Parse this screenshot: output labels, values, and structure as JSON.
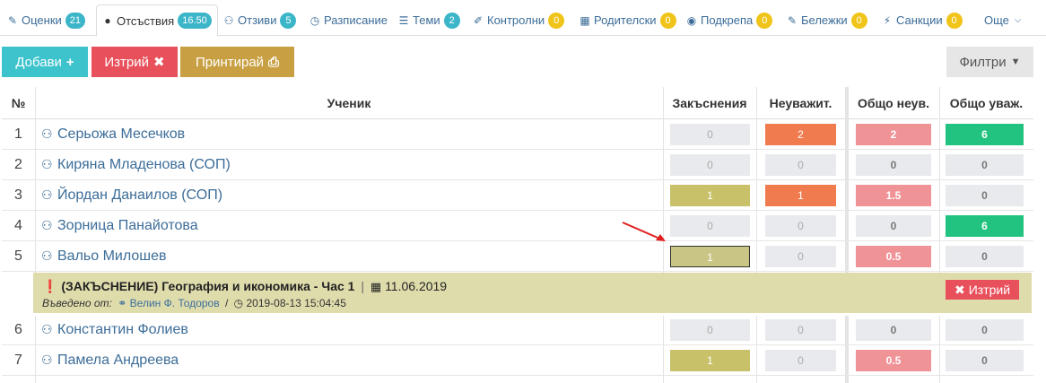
{
  "tabs": [
    {
      "label": "Оценки",
      "badge": "21",
      "badge_color": "teal",
      "icon": "pencil-icon",
      "glyph": "✎"
    },
    {
      "label": "Отсъствия",
      "badge": "16.50",
      "badge_color": "teal",
      "icon": "exclamation-circle-icon",
      "glyph": "❗",
      "active": true
    },
    {
      "label": "Отзиви",
      "badge": "5",
      "badge_color": "teal",
      "icon": "users-icon",
      "glyph": "⚇"
    },
    {
      "label": "Разписание",
      "icon": "clock-icon",
      "glyph": "◷"
    },
    {
      "label": "Теми",
      "badge": "2",
      "badge_color": "teal",
      "icon": "list-icon",
      "glyph": "☰"
    },
    {
      "label": "Контролни",
      "badge": "0",
      "badge_color": "yellow",
      "icon": "edit-icon",
      "glyph": "✐"
    },
    {
      "label": "Родителски",
      "badge": "0",
      "badge_color": "yellow",
      "icon": "calendar-icon",
      "glyph": "▦"
    },
    {
      "label": "Подкрепа",
      "badge": "0",
      "badge_color": "yellow",
      "icon": "eye-icon",
      "glyph": "◉"
    },
    {
      "label": "Бележки",
      "badge": "0",
      "badge_color": "yellow",
      "icon": "note-icon",
      "glyph": "✎"
    },
    {
      "label": "Санкции",
      "badge": "0",
      "badge_color": "yellow",
      "icon": "bolt-icon",
      "glyph": "⚡"
    },
    {
      "label": "Още",
      "icon": "chevron-down-icon",
      "glyph": "⌄"
    }
  ],
  "toolbar": {
    "add_label": "Добави",
    "add_icon": "+",
    "delete_label": "Изтрий",
    "delete_icon": "✖",
    "print_label": "Принтирай",
    "print_icon": "⎙",
    "filter_label": "Филтри",
    "filter_icon": "▼"
  },
  "table": {
    "headers": {
      "num": "№",
      "student": "Ученик",
      "late": "Закъснения",
      "unexcused": "Неуважит.",
      "total_unexcused": "Общо неув.",
      "total_excused": "Общо уваж."
    },
    "rows": [
      {
        "num": "1",
        "name": "Серьожа Месечков",
        "late": "0",
        "unexcused": "2",
        "total_unexcused": "2",
        "total_excused": "6"
      },
      {
        "num": "2",
        "name": "Киряна Младенова (СОП)",
        "late": "0",
        "unexcused": "0",
        "total_unexcused": "0",
        "total_excused": "0"
      },
      {
        "num": "3",
        "name": "Йордан Данаилов (СОП)",
        "late": "1",
        "unexcused": "1",
        "total_unexcused": "1.5",
        "total_excused": "0"
      },
      {
        "num": "4",
        "name": "Зорница Панайотова",
        "late": "0",
        "unexcused": "0",
        "total_unexcused": "0",
        "total_excused": "6"
      },
      {
        "num": "5",
        "name": "Вальо Милошев",
        "late": "1",
        "unexcused": "0",
        "total_unexcused": "0.5",
        "total_excused": "0"
      },
      {
        "num": "6",
        "name": "Константин Фолиев",
        "late": "0",
        "unexcused": "0",
        "total_unexcused": "0",
        "total_excused": "0"
      },
      {
        "num": "7",
        "name": "Памела Андреева",
        "late": "1",
        "unexcused": "0",
        "total_unexcused": "0.5",
        "total_excused": "0"
      }
    ]
  },
  "detail": {
    "title": "(ЗАКЪСНЕНИЕ) География и икономика - Час 1",
    "separator": "|",
    "date": "11.06.2019",
    "entered_by_label": "Въведено от:",
    "entered_by": "Велин Ф. Тодоров",
    "slash": "/",
    "timestamp": "2019-08-13 15:04:45",
    "delete_label": "Изтрий"
  },
  "colors": {
    "accent_teal": "#3cc3cc",
    "danger": "#e8505b",
    "print": "#c8a043",
    "olive": "#c8c16a",
    "orange": "#f07b4f",
    "pink": "#f09397",
    "green": "#22c280",
    "link": "#3c6d99"
  }
}
